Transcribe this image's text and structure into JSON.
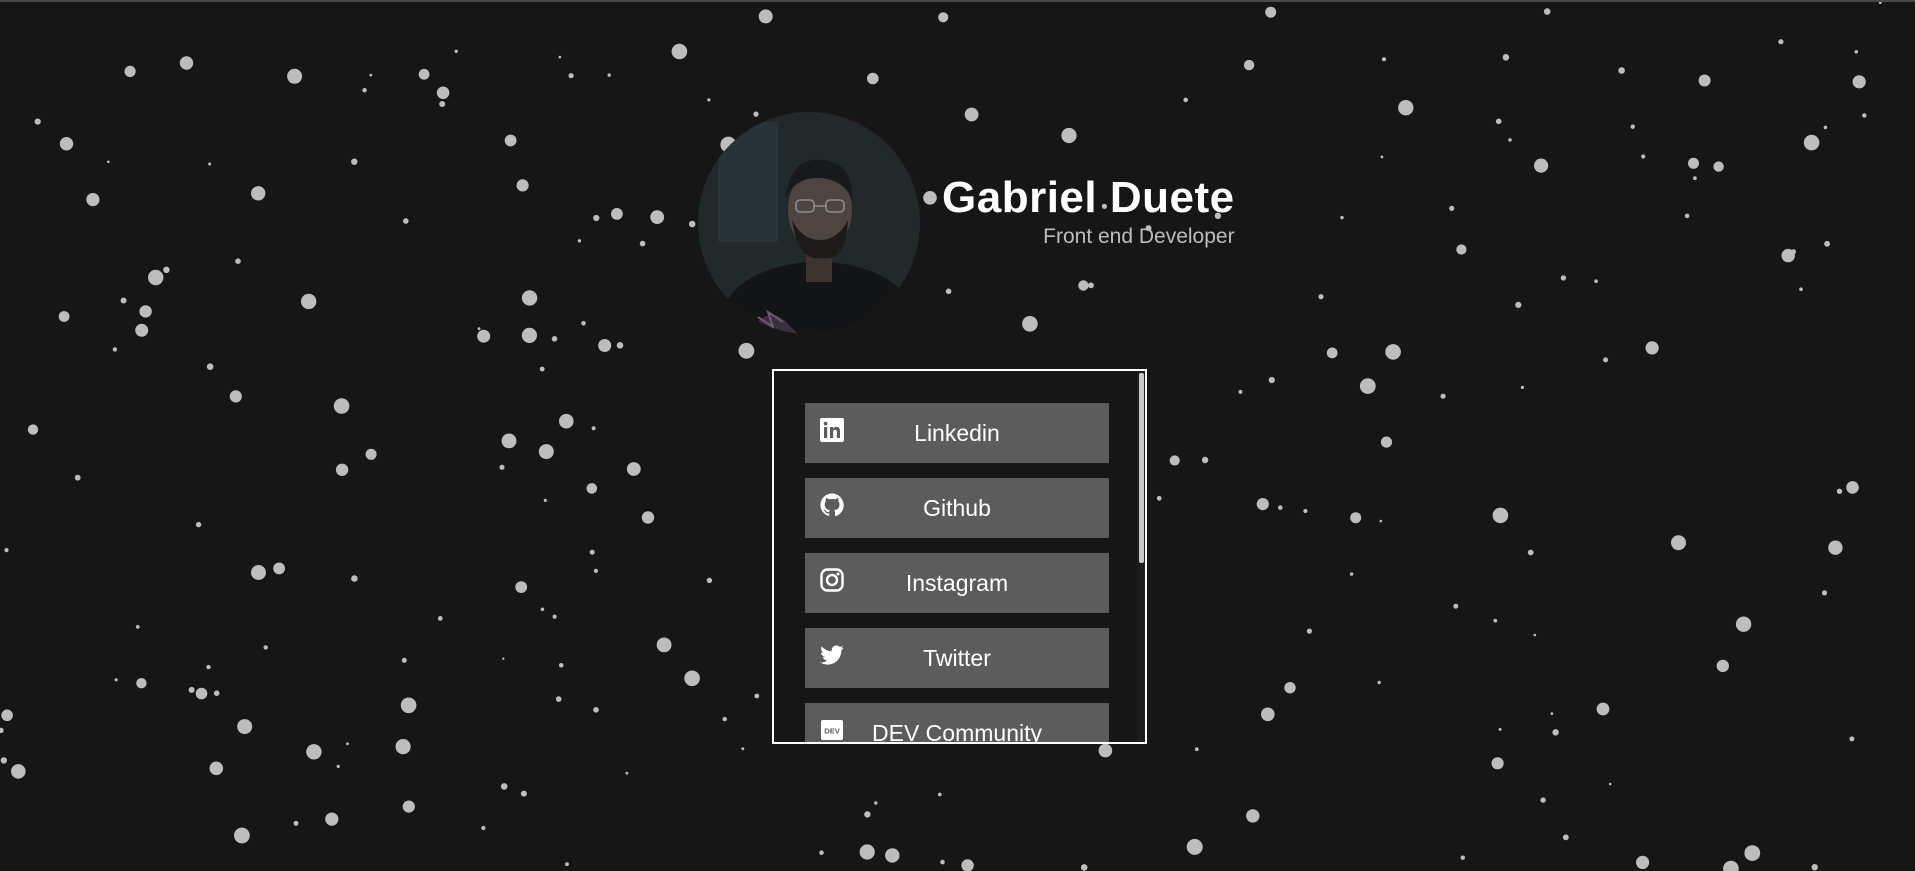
{
  "profile": {
    "name": "Gabriel Duete",
    "role": "Front end Developer"
  },
  "links": [
    {
      "label": "Linkedin",
      "icon": "linkedin-icon"
    },
    {
      "label": "Github",
      "icon": "github-icon"
    },
    {
      "label": "Instagram",
      "icon": "instagram-icon"
    },
    {
      "label": "Twitter",
      "icon": "twitter-icon"
    },
    {
      "label": "DEV Community",
      "icon": "dev-community-icon"
    }
  ],
  "colors": {
    "background": "#161616",
    "button": "#5c5c5c",
    "particle": "#bdbdbd",
    "box_border": "#ffffff"
  }
}
